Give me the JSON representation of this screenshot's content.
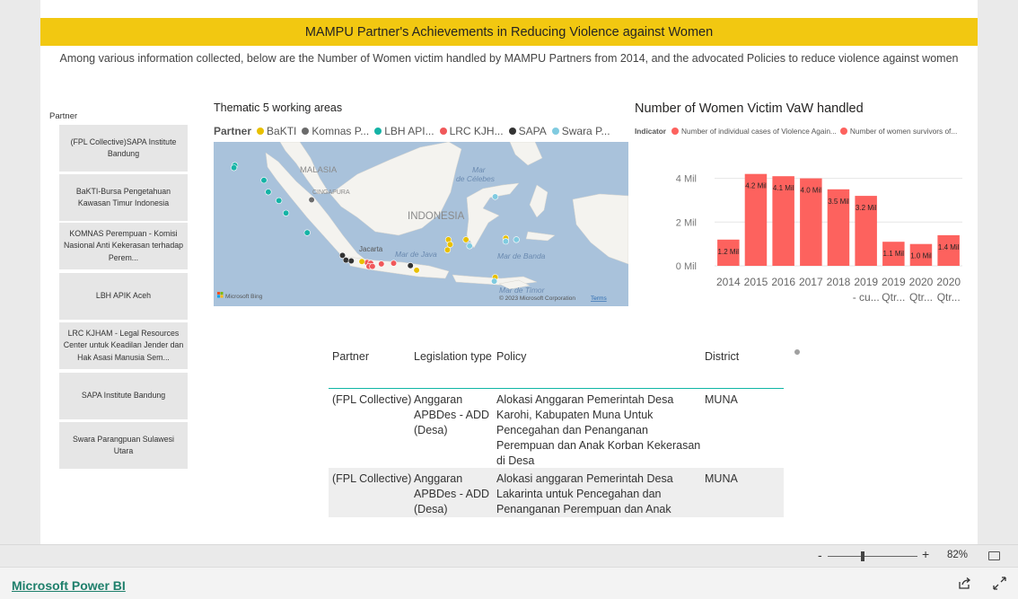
{
  "report": {
    "banner_title": "MAMPU Partner's Achievements in Reducing Violence against Women",
    "subtitle": "Among various information collected, below are the Number of Women victim handled by MAMPU Partners from 2014, and the advocated Policies to reduce violence against women"
  },
  "slicer": {
    "title": "Partner",
    "items": [
      "(FPL Collective)SAPA Institute Bandung",
      "BaKTI-Bursa Pengetahuan Kawasan Timur Indonesia",
      "KOMNAS Perempuan - Komisi Nasional Anti Kekerasan terhadap Perempuan",
      "LBH APIK Aceh",
      "LRC KJHAM - Legal Resources Center untuk Keadilan Jender dan Hak Asasi Manusia Semarang",
      "SAPA Institute Bandung",
      "Swara Parangpuan Sulawesi Utara"
    ],
    "items_display": [
      "(FPL Collective)SAPA Institute Bandung",
      "BaKTI-Bursa Pengetahuan Kawasan Timur Indonesia",
      "KOMNAS Perempuan - Komisi Nasional Anti Kekerasan terhadap Perem...",
      "LBH APIK Aceh",
      "LRC KJHAM - Legal Resources Center untuk Keadilan Jender dan Hak Asasi Manusia Sem...",
      "SAPA Institute Bandung",
      "Swara Parangpuan Sulawesi Utara"
    ]
  },
  "map": {
    "title": "Thematic 5 working areas",
    "legend_title": "Partner",
    "legend": [
      {
        "label": "BaKTI",
        "color": "#e8c000"
      },
      {
        "label": "Komnas P...",
        "color": "#6b6b6b"
      },
      {
        "label": "LBH API...",
        "color": "#15b3a6"
      },
      {
        "label": "LRC KJH...",
        "color": "#f0585a"
      },
      {
        "label": "SAPA",
        "color": "#333333"
      },
      {
        "label": "Swara P...",
        "color": "#80cbe0"
      }
    ],
    "labels": {
      "malasia": "MALASIA",
      "singapura": "CINGAPURA",
      "indonesia": "INDONESIA",
      "celebes_line1": "Mar",
      "celebes_line2": "de Célebes",
      "java_sea": "Mar de Java",
      "banda": "Mar de Banda",
      "jakarta": "Jacarta",
      "timor": "Mar de Timor",
      "bing": "Microsoft Bing",
      "copyright": "© 2023 Microsoft Corporation",
      "terms": "Terms"
    },
    "points": [
      {
        "partner": "LBH API...",
        "lon": 95.4,
        "lat": 5.5
      },
      {
        "partner": "LBH API...",
        "lon": 95.3,
        "lat": 5.2
      },
      {
        "partner": "LBH API...",
        "lon": 98.7,
        "lat": 3.6
      },
      {
        "partner": "LBH API...",
        "lon": 99.2,
        "lat": 2.1
      },
      {
        "partner": "LBH API...",
        "lon": 100.4,
        "lat": 1.0
      },
      {
        "partner": "LBH API...",
        "lon": 101.2,
        "lat": -0.6
      },
      {
        "partner": "LBH API...",
        "lon": 103.6,
        "lat": -3.1
      },
      {
        "partner": "Komnas P...",
        "lon": 104.1,
        "lat": 1.1
      },
      {
        "partner": "SAPA",
        "lon": 107.6,
        "lat": -6.0
      },
      {
        "partner": "SAPA",
        "lon": 108.0,
        "lat": -6.6
      },
      {
        "partner": "SAPA",
        "lon": 108.6,
        "lat": -6.7
      },
      {
        "partner": "SAPA",
        "lon": 115.3,
        "lat": -7.3
      },
      {
        "partner": "LRC KJH...",
        "lon": 110.4,
        "lat": -6.9
      },
      {
        "partner": "LRC KJH...",
        "lon": 110.8,
        "lat": -7.0
      },
      {
        "partner": "LRC KJH...",
        "lon": 110.6,
        "lat": -7.4
      },
      {
        "partner": "LRC KJH...",
        "lon": 111.0,
        "lat": -7.4
      },
      {
        "partner": "LRC KJH...",
        "lon": 112.0,
        "lat": -7.1
      },
      {
        "partner": "LRC KJH...",
        "lon": 113.4,
        "lat": -7.0
      },
      {
        "partner": "BaKTI",
        "lon": 109.8,
        "lat": -6.8
      },
      {
        "partner": "BaKTI",
        "lon": 116.0,
        "lat": -7.9
      },
      {
        "partner": "BaKTI",
        "lon": 119.6,
        "lat": -4.0
      },
      {
        "partner": "BaKTI",
        "lon": 119.8,
        "lat": -4.6
      },
      {
        "partner": "BaKTI",
        "lon": 119.5,
        "lat": -5.3
      },
      {
        "partner": "BaKTI",
        "lon": 121.6,
        "lat": -4.0
      },
      {
        "partner": "BaKTI",
        "lon": 126.1,
        "lat": -3.8
      },
      {
        "partner": "BaKTI",
        "lon": 124.9,
        "lat": -8.8
      },
      {
        "partner": "Swara P...",
        "lon": 124.9,
        "lat": 1.5
      },
      {
        "partner": "Swara P...",
        "lon": 122.0,
        "lat": -4.8
      },
      {
        "partner": "Swara P...",
        "lon": 126.1,
        "lat": -4.2
      },
      {
        "partner": "Swara P...",
        "lon": 127.3,
        "lat": -4.0
      },
      {
        "partner": "Swara P...",
        "lon": 124.8,
        "lat": -9.3
      }
    ]
  },
  "chart": {
    "title": "Number of Women Victim VaW handled",
    "legend_title": "Indicator",
    "legend": [
      "Number of individual cases of Violence Again...",
      "Number of women survivors of..."
    ],
    "bar_color": "#fd625e"
  },
  "chart_data": {
    "type": "bar",
    "title": "Number of Women Victim VaW handled",
    "categories": [
      "2014",
      "2015",
      "2016",
      "2017",
      "2018",
      "2019 - cu...",
      "2019 Qtr...",
      "2020 Qtr...",
      "2020 Qtr..."
    ],
    "category_lines": [
      [
        "2014"
      ],
      [
        "2015"
      ],
      [
        "2016"
      ],
      [
        "2017"
      ],
      [
        "2018"
      ],
      [
        "2019",
        "- cu..."
      ],
      [
        "2019",
        "Qtr..."
      ],
      [
        "2020",
        "Qtr..."
      ],
      [
        "2020",
        "Qtr..."
      ]
    ],
    "values": [
      1.2,
      4.2,
      4.1,
      4.0,
      3.5,
      3.2,
      1.1,
      1.0,
      1.4
    ],
    "data_labels": [
      "1.2 Mil",
      "4.2 Mil",
      "4.1 Mil",
      "4.0 Mil",
      "3.5 Mil",
      "3.2 Mil",
      "1.1 Mil",
      "1.0 Mil",
      "1.4 Mil"
    ],
    "yticks": [
      0,
      2,
      4
    ],
    "ytick_labels": [
      "0 Mil",
      "2 Mil",
      "4 Mil"
    ],
    "ylim": [
      0,
      4.6
    ],
    "grid": true
  },
  "table": {
    "headers": [
      "Partner",
      "Legislation type",
      "Policy",
      "District"
    ],
    "rows": [
      {
        "partner": "(FPL Collective)",
        "legislation_type": "Anggaran APBDes - ADD (Desa)",
        "policy": "Alokasi Anggaran Pemerintah Desa Karohi, Kabupaten Muna Untuk Pencegahan dan Penanganan Perempuan dan Anak Korban Kekerasan di Desa",
        "district": "MUNA"
      },
      {
        "partner": "(FPL Collective)",
        "legislation_type": "Anggaran APBDes - ADD (Desa)",
        "policy": "Alokasi anggaran Pemerintah Desa Lakarinta untuk Pencegahan dan Penanganan Perempuan dan Anak",
        "district": "MUNA"
      }
    ]
  },
  "zoom": {
    "minus": "-",
    "plus": "+",
    "value": "82%"
  },
  "footer": {
    "brand": "Microsoft Power BI"
  }
}
